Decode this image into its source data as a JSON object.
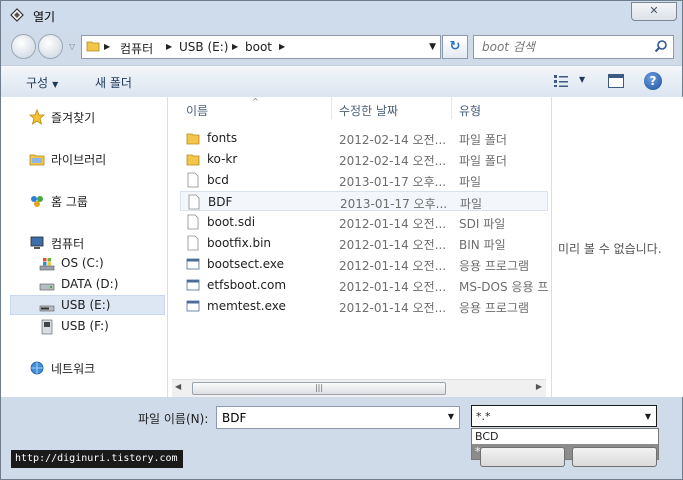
{
  "window": {
    "title": "열기",
    "close_label": "✕"
  },
  "address": {
    "crumbs": [
      "컴퓨터",
      "USB (E:)",
      "boot"
    ]
  },
  "search": {
    "placeholder": "boot 검색"
  },
  "toolbar": {
    "organize_label": "구성",
    "new_folder_label": "새 폴더",
    "help_label": "?"
  },
  "nav": {
    "favorites_label": "즐겨찾기",
    "libraries_label": "라이브러리",
    "homegroup_label": "홈 그룹",
    "computer_label": "컴퓨터",
    "drives": [
      "OS (C:)",
      "DATA (D:)",
      "USB (E:)",
      "USB (F:)"
    ],
    "network_label": "네트워크"
  },
  "columns": {
    "name": "이름",
    "date": "수정한 날짜",
    "type": "유형"
  },
  "files": [
    {
      "name": "fonts",
      "date": "2012-02-14 오전...",
      "type": "파일 폴더",
      "icon": "folder-icon"
    },
    {
      "name": "ko-kr",
      "date": "2012-02-14 오전...",
      "type": "파일 폴더",
      "icon": "folder-icon"
    },
    {
      "name": "bcd",
      "date": "2013-01-17 오후...",
      "type": "파일",
      "icon": "file-icon"
    },
    {
      "name": "BDF",
      "date": "2013-01-17 오후...",
      "type": "파일",
      "icon": "file-icon"
    },
    {
      "name": "boot.sdi",
      "date": "2012-01-14 오전...",
      "type": "SDI 파일",
      "icon": "file-icon"
    },
    {
      "name": "bootfix.bin",
      "date": "2012-01-14 오전...",
      "type": "BIN 파일",
      "icon": "file-icon"
    },
    {
      "name": "bootsect.exe",
      "date": "2012-01-14 오전...",
      "type": "응용 프로그램",
      "icon": "exe-icon"
    },
    {
      "name": "etfsboot.com",
      "date": "2012-01-14 오전...",
      "type": "MS-DOS 응용 프로그램",
      "icon": "exe-icon"
    },
    {
      "name": "memtest.exe",
      "date": "2012-01-14 오전...",
      "type": "응용 프로그램",
      "icon": "exe-icon"
    }
  ],
  "preview": {
    "message": "미리 볼 수 없습니다."
  },
  "bottom": {
    "filename_label": "파일 이름(N):",
    "filename_value": "BDF",
    "filetype_value": "*.*",
    "filetype_options": [
      "BCD",
      "*.*"
    ]
  },
  "watermark": "http://diginuri.tistory.com",
  "colors": {
    "accent": "#2a6fc9",
    "frame": "#cfdbe9",
    "selection": "#dde7f3"
  }
}
